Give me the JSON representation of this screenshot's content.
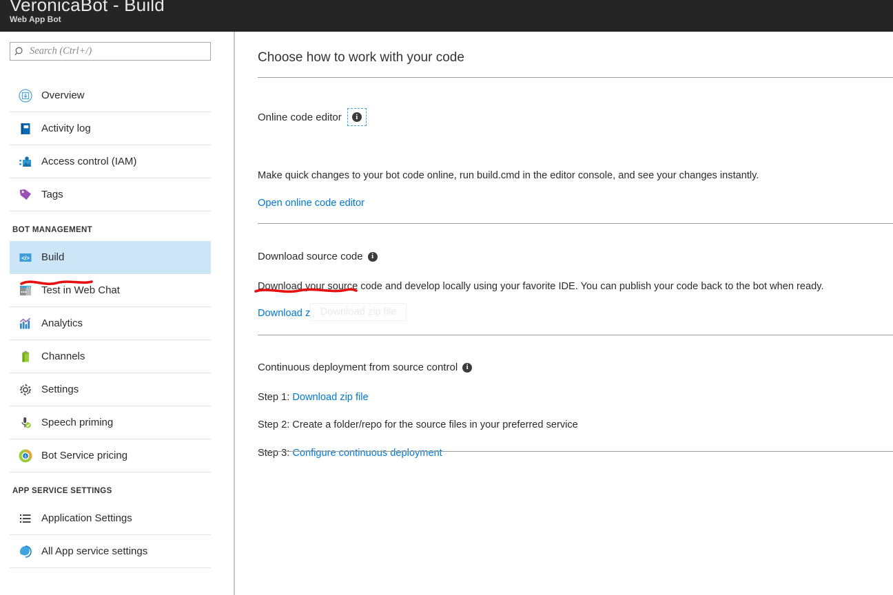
{
  "header": {
    "title": "VeronicaBot - Build",
    "subtitle": "Web App Bot"
  },
  "search": {
    "placeholder": "Search (Ctrl+/)",
    "value": "",
    "icon": "search-icon"
  },
  "sidebar": {
    "groups": [
      {
        "title": "",
        "items": [
          {
            "label": "Overview",
            "icon": "overview-icon",
            "selected": false
          },
          {
            "label": "Activity log",
            "icon": "activity-log-icon",
            "selected": false
          },
          {
            "label": "Access control (IAM)",
            "icon": "access-control-icon",
            "selected": false
          },
          {
            "label": "Tags",
            "icon": "tag-icon",
            "selected": false
          }
        ]
      },
      {
        "title": "BOT MANAGEMENT",
        "items": [
          {
            "label": "Build",
            "icon": "code-brackets-icon",
            "selected": true
          },
          {
            "label": "Test in Web Chat",
            "icon": "web-chat-icon",
            "selected": false
          },
          {
            "label": "Analytics",
            "icon": "analytics-chart-icon",
            "selected": false
          },
          {
            "label": "Channels",
            "icon": "channels-icon",
            "selected": false
          },
          {
            "label": "Settings",
            "icon": "gear-icon",
            "selected": false
          },
          {
            "label": "Speech priming",
            "icon": "microphone-check-icon",
            "selected": false
          },
          {
            "label": "Bot Service pricing",
            "icon": "pricing-donut-icon",
            "selected": false
          }
        ]
      },
      {
        "title": "APP SERVICE SETTINGS",
        "items": [
          {
            "label": "Application Settings",
            "icon": "list-icon",
            "selected": false
          },
          {
            "label": "All App service settings",
            "icon": "app-service-icon",
            "selected": false
          }
        ]
      }
    ]
  },
  "main": {
    "heading": "Choose how to work with your code",
    "sections": [
      {
        "title": "Online code editor",
        "info_icon": "info-icon",
        "description": "Make quick changes to your bot code online, run build.cmd in the editor console, and see your changes instantly.",
        "link": "Open online code editor"
      },
      {
        "title": "Download source code",
        "info_icon": "info-icon",
        "description": "Download your source code and develop locally using your favorite IDE. You can publish your code back to the bot when ready.",
        "link": "Download zip file"
      },
      {
        "title": "Continuous deployment from source control",
        "info_icon": "info-icon",
        "steps": [
          {
            "label": "Step 1: ",
            "link": "Download zip file"
          },
          {
            "label": "Step 2: Create a folder/repo for the source files in your preferred service",
            "link": ""
          },
          {
            "label": "Step 3: ",
            "link": "Configure continuous deployment"
          }
        ]
      }
    ],
    "ghost_tooltip": "Download zip file"
  },
  "colors": {
    "header_bg": "#252525",
    "selected_nav_bg": "#cde6f7",
    "link": "#0077d4",
    "annotation": "#e51010",
    "focus_outline": "#3ea3e0"
  }
}
